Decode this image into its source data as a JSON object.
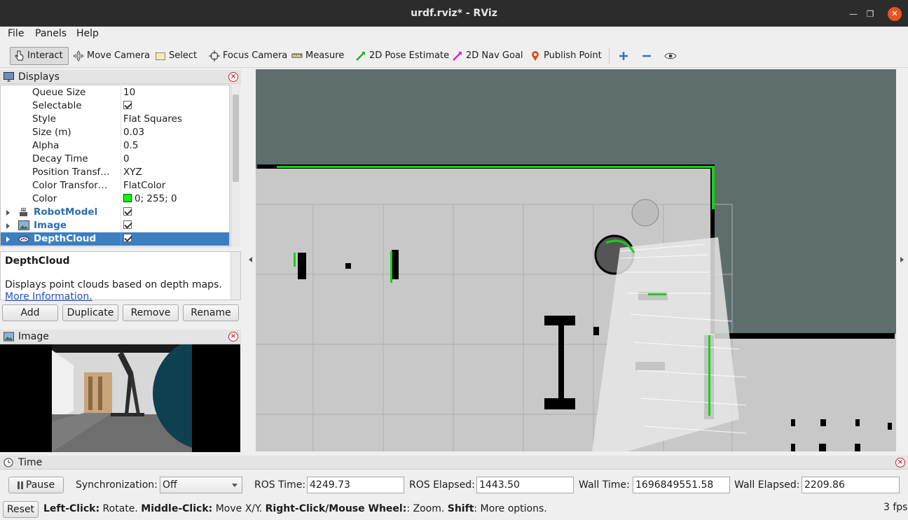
{
  "window": {
    "title": "urdf.rviz* - RViz"
  },
  "menu": {
    "file": "File",
    "panels": "Panels",
    "help": "Help"
  },
  "toolbar": {
    "interact": "Interact",
    "move_camera": "Move Camera",
    "select": "Select",
    "focus_camera": "Focus Camera",
    "measure": "Measure",
    "pose_estimate": "2D Pose Estimate",
    "nav_goal": "2D Nav Goal",
    "publish_point": "Publish Point"
  },
  "displays": {
    "title": "Displays",
    "properties": [
      {
        "key": "Queue Size",
        "value": "10"
      },
      {
        "key": "Selectable",
        "value": ""
      },
      {
        "key": "Style",
        "value": "Flat Squares"
      },
      {
        "key": "Size (m)",
        "value": "0.03"
      },
      {
        "key": "Alpha",
        "value": "0.5"
      },
      {
        "key": "Decay Time",
        "value": "0"
      },
      {
        "key": "Position Transf…",
        "value": "XYZ"
      },
      {
        "key": "Color Transfor…",
        "value": "FlatColor"
      },
      {
        "key": "Color",
        "value": "0; 255; 0"
      }
    ],
    "items": [
      {
        "label": "RobotModel"
      },
      {
        "label": "Image"
      },
      {
        "label": "DepthCloud"
      }
    ],
    "color_swatch": "#00ff00"
  },
  "description": {
    "title": "DepthCloud",
    "text": "Displays point clouds based on depth maps.",
    "link": "More Information."
  },
  "buttons": {
    "add": "Add",
    "duplicate": "Duplicate",
    "remove": "Remove",
    "rename": "Rename"
  },
  "image_panel": {
    "title": "Image"
  },
  "time": {
    "title": "Time",
    "pause": "Pause",
    "sync_label": "Synchronization:",
    "sync_value": "Off",
    "ros_time_label": "ROS Time:",
    "ros_time": "4249.73",
    "ros_elapsed_label": "ROS Elapsed:",
    "ros_elapsed": "1443.50",
    "wall_time_label": "Wall Time:",
    "wall_time": "1696849551.58",
    "wall_elapsed_label": "Wall Elapsed:",
    "wall_elapsed": "2209.86",
    "reset": "Reset",
    "fps": "3 fps"
  },
  "status": {
    "b1": "Left-Click:",
    "t1": " Rotate. ",
    "b2": "Middle-Click:",
    "t2": " Move X/Y. ",
    "b3": "Right-Click/Mouse Wheel:",
    "t3": ": Zoom. ",
    "b4": "Shift",
    "t4": ": More options."
  },
  "colors": {
    "accent": "#3c7fc1",
    "close": "#e95420",
    "map_free": "#c8c8c8",
    "map_unknown": "#5e6e6c"
  }
}
